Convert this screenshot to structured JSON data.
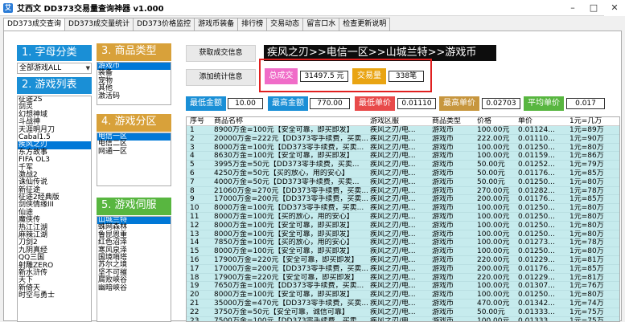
{
  "window": {
    "title": "艾西文 DD373交易量查询神器 v1.000",
    "icon": "app-logo-icon"
  },
  "tabs": [
    "DD373成交查询",
    "DD373成交量统计",
    "DD373价格监控",
    "游戏币装备",
    "排行榜",
    "交易动态",
    "留言口水",
    "检查更新说明"
  ],
  "sidebar": {
    "letter_head": "1. 字母分类",
    "letter_select": "全部游戏ALL",
    "games_head": "2. 游戏列表",
    "games": [
      "征途2S",
      "剑灵",
      "幻想神域",
      "斗战神",
      "天涯明月刀",
      "Cabal1.5",
      "疾风之刃",
      "东方故事",
      "FIFA OL3",
      "千军",
      "激战2",
      "诛仙传说",
      "新征途",
      "征途2经典版",
      "剑侠情缘III",
      "仙途",
      "魔侠传",
      "热江江湖",
      "麻辣江湖",
      "刀剑2",
      "九阴真经",
      "QQ三国",
      "射雕ZERO",
      "新水浒传",
      "天下",
      "新倚天",
      "时空与勇士"
    ],
    "games_selected": 6,
    "type_head": "3. 商品类型",
    "types": [
      "游戏币",
      "装备",
      "宠物",
      "其他",
      "激活码"
    ],
    "type_selected": 0,
    "zone_head": "4. 游戏分区",
    "zones": [
      "电信一区",
      "电信二区",
      "网通一区"
    ],
    "zone_selected": 0,
    "server_head": "5. 游戏伺服",
    "servers": [
      "山城兰特",
      "蛛网森林",
      "鲁昆恩重",
      "红色沼泽",
      "寒风泉泽",
      "国境哨塔",
      "苏尔之境",
      "坚不可摧",
      "腐败峡谷",
      "幽暗峡谷"
    ],
    "server_selected": 0
  },
  "buttons": {
    "get_deals": "获取成交信息",
    "add_stats": "添加统计信息"
  },
  "banner": "疾风之刃>>电信一区>>山城兰特>>游戏币",
  "stats": {
    "total_label": "总成交",
    "total_value": "31497.5 元",
    "volume_label": "交易量",
    "volume_value": "338笔"
  },
  "metrics": [
    {
      "label": "最低金额",
      "value": "10.00"
    },
    {
      "label": "最高金额",
      "value": "770.00"
    },
    {
      "label": "最低单价",
      "value": "0.01110"
    },
    {
      "label": "最高单价",
      "value": "0.02703"
    },
    {
      "label": "平均单价",
      "value": "0.017"
    }
  ],
  "table": {
    "columns": [
      "序号",
      "商品名称",
      "游戏区服",
      "商品类型",
      "价格",
      "单价",
      "1元=几万"
    ],
    "rows": [
      [
        "1",
        "8900万金=100元【安全可靠，即买即发】",
        "疾风之刃/电...",
        "游戏币",
        "100.00元",
        "0.01124...",
        "1元=89万"
      ],
      [
        "2",
        "20000万金=222元【DD373零手续费，买卖...",
        "疾风之刃/电...",
        "游戏币",
        "222.00元",
        "0.01110...",
        "1元=90万"
      ],
      [
        "3",
        "8000万金=100元【DD373零手续费，买卖...",
        "疾风之刃/电...",
        "游戏币",
        "100.00元",
        "0.01250...",
        "1元=80万"
      ],
      [
        "4",
        "8630万金=100元【安全可靠，即买即发】",
        "疾风之刃/电...",
        "游戏币",
        "100.00元",
        "0.01159...",
        "1元=86万"
      ],
      [
        "5",
        "3995万金=50元【DD373零手续费，买卖...",
        "疾风之刃/电...",
        "游戏币",
        "50.00元",
        "0.01252...",
        "1元=79万"
      ],
      [
        "6",
        "4250万金=50元【买的放心，用的安心】",
        "疾风之刃/电...",
        "游戏币",
        "50.00元",
        "0.01176...",
        "1元=85万"
      ],
      [
        "7",
        "4000万金=50元【DD373零手续费，买卖...",
        "疾风之刃/电...",
        "游戏币",
        "50.00元",
        "0.01250...",
        "1元=80万"
      ],
      [
        "8",
        "21060万金=270元【DD373零手续费，买卖...",
        "疾风之刃/电...",
        "游戏币",
        "270.00元",
        "0.01282...",
        "1元=78万"
      ],
      [
        "9",
        "17000万金=200元【DD373零手续费，买卖...",
        "疾风之刃/电...",
        "游戏币",
        "200.00元",
        "0.01176...",
        "1元=85万"
      ],
      [
        "10",
        "8000万金=100元【DD373零手续费，买卖...",
        "疾风之刃/电...",
        "游戏币",
        "100.00元",
        "0.01250...",
        "1元=80万"
      ],
      [
        "11",
        "8000万金=100元【买的放心，用的安心】",
        "疾风之刃/电...",
        "游戏币",
        "100.00元",
        "0.01250...",
        "1元=80万"
      ],
      [
        "12",
        "8000万金=100元【安全可靠，即买即发】",
        "疾风之刃/电...",
        "游戏币",
        "100.00元",
        "0.01250...",
        "1元=80万"
      ],
      [
        "13",
        "8000万金=100元【安全可靠，即买即发】",
        "疾风之刃/电...",
        "游戏币",
        "100.00元",
        "0.01250...",
        "1元=80万"
      ],
      [
        "14",
        "7850万金=100元【买的放心，用的安心】",
        "疾风之刃/电...",
        "游戏币",
        "100.00元",
        "0.01273...",
        "1元=78万"
      ],
      [
        "15",
        "8000万金=100元【安全可靠，即买即发】",
        "疾风之刃/电...",
        "游戏币",
        "100.00元",
        "0.01250...",
        "1元=80万"
      ],
      [
        "16",
        "17900万金=220元【安全可靠，即买即发】",
        "疾风之刃/电...",
        "游戏币",
        "220.00元",
        "0.01229...",
        "1元=81万"
      ],
      [
        "17",
        "17000万金=200元【DD373零手续费，买卖...",
        "疾风之刃/电...",
        "游戏币",
        "200.00元",
        "0.01176...",
        "1元=85万"
      ],
      [
        "18",
        "17900万金=220元【安全可靠，即买即发】",
        "疾风之刃/电...",
        "游戏币",
        "220.00元",
        "0.01229...",
        "1元=81万"
      ],
      [
        "19",
        "7650万金=100元【DD373零手续费，买卖...",
        "疾风之刃/电...",
        "游戏币",
        "100.00元",
        "0.01307...",
        "1元=76万"
      ],
      [
        "20",
        "8000万金=100元【安全可靠，即买即发】",
        "疾风之刃/电...",
        "游戏币",
        "100.00元",
        "0.01250...",
        "1元=80万"
      ],
      [
        "21",
        "35000万金=470元【DD373零手续费，买卖...",
        "疾风之刃/电...",
        "游戏币",
        "470.00元",
        "0.01342...",
        "1元=74万"
      ],
      [
        "22",
        "3750万金=50元【安全可靠，诚信可靠】",
        "疾风之刃/电...",
        "游戏币",
        "50.00元",
        "0.01333...",
        "1元=75万"
      ],
      [
        "23",
        "7500万金=100元【DD373零手续费，买卖...",
        "疾风之刃/电...",
        "游戏币",
        "100.00元",
        "0.01333...",
        "1元=75万"
      ]
    ]
  }
}
